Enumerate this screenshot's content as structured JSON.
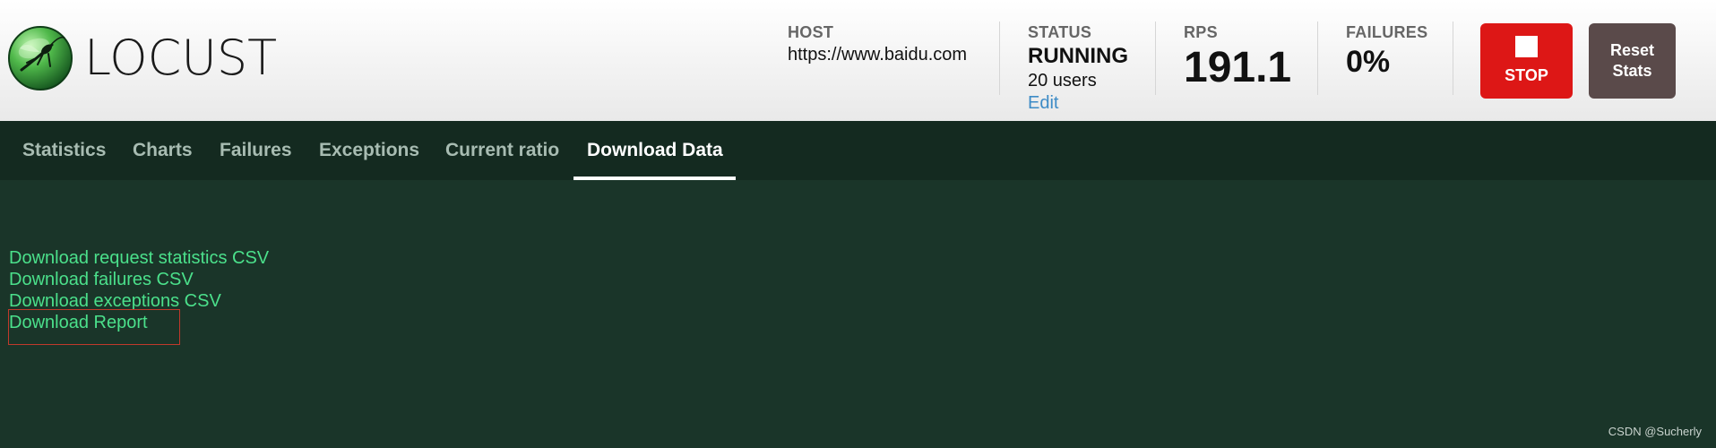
{
  "app": {
    "logo_text": "LOCUST",
    "logo_icon": "locust-insect-icon"
  },
  "stats": {
    "host": {
      "label": "HOST",
      "value": "https://www.baidu.com"
    },
    "status": {
      "label": "STATUS",
      "value": "RUNNING",
      "users": "20 users",
      "edit_label": "Edit"
    },
    "rps": {
      "label": "RPS",
      "value": "191.1"
    },
    "failures": {
      "label": "FAILURES",
      "value": "0%"
    }
  },
  "buttons": {
    "stop_label": "STOP",
    "stop_icon": "stop-square-icon",
    "reset_label_line1": "Reset",
    "reset_label_line2": "Stats"
  },
  "tabs": [
    {
      "label": "Statistics"
    },
    {
      "label": "Charts"
    },
    {
      "label": "Failures"
    },
    {
      "label": "Exceptions"
    },
    {
      "label": "Current ratio"
    },
    {
      "label": "Download Data",
      "active": true
    }
  ],
  "downloads": [
    {
      "label": "Download request statistics CSV"
    },
    {
      "label": "Download failures CSV"
    },
    {
      "label": "Download exceptions CSV"
    },
    {
      "label": "Download Report",
      "highlighted": true
    }
  ],
  "watermark": "CSDN @Sucherly",
  "colors": {
    "stop_button": "#dd1716",
    "reset_button": "#5a4a4a",
    "link": "#4be08b",
    "edit_link": "#3d8bc6",
    "content_bg": "#1a3529",
    "nav_bg": "#142a20",
    "highlight_border": "#c0392b"
  }
}
